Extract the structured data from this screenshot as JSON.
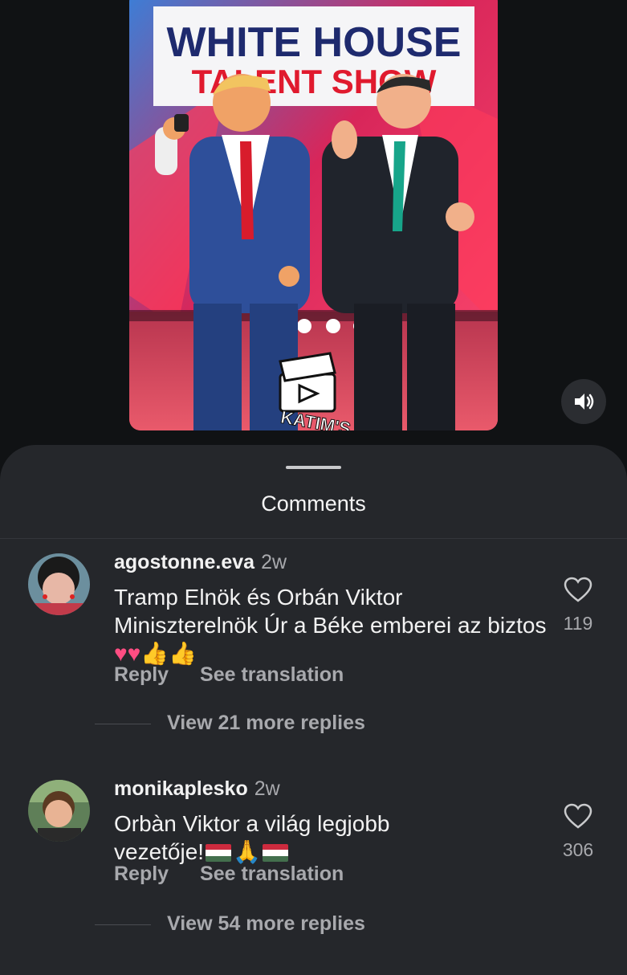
{
  "video": {
    "sign_line1": "WHITE HOUSE",
    "sign_line2": "TALENT SHOW",
    "watermark": "KATIM'S"
  },
  "sheet": {
    "title": "Comments"
  },
  "comments": [
    {
      "username": "agostonne.eva",
      "time": "2w",
      "text_main": "Tramp Elnök és Orbán Viktor Miniszterelnök Úr a Béke emberei az biztos",
      "emojis": [
        "heart",
        "heart",
        "thumbs-up",
        "thumbs-up"
      ],
      "likes": "119",
      "reply_label": "Reply",
      "translate_label": "See translation",
      "view_replies": "View 21 more replies"
    },
    {
      "username": "monikaplesko",
      "time": "2w",
      "text_main": "Orbàn Viktor a világ legjobb vezetője!",
      "emojis": [
        "hungary-flag",
        "folded-hands",
        "hungary-flag"
      ],
      "likes": "306",
      "reply_label": "Reply",
      "translate_label": "See translation",
      "view_replies": "View 54 more replies"
    }
  ],
  "colors": {
    "background": "#101214",
    "sheet": "#25272b",
    "muted_text": "#a8a9ad",
    "heart_emoji": "#ff4d82"
  }
}
